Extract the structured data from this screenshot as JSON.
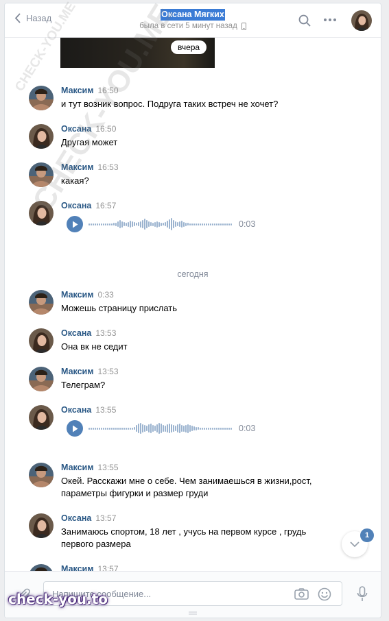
{
  "header": {
    "back_label": "Назад",
    "title": "Оксана Мягких",
    "status": "была в сети 5 минут назад"
  },
  "media_badge": "вчера",
  "messages": [
    {
      "name": "Максим",
      "time": "16:50",
      "text": "и тут возник вопрос. Подруга таких встреч не хочет?"
    },
    {
      "name": "Оксана",
      "time": "16:50",
      "text": "Другая может"
    },
    {
      "name": "Максим",
      "time": "16:53",
      "text": "какая?"
    },
    {
      "name": "Оксана",
      "time": "16:57",
      "voice_duration": "0:03"
    },
    {
      "name": "Максим",
      "time": "0:33",
      "text": "Можешь страницу прислать"
    },
    {
      "name": "Оксана",
      "time": "13:53",
      "text": "Она вк не седит"
    },
    {
      "name": "Максим",
      "time": "13:53",
      "text": "Телеграм?"
    },
    {
      "name": "Оксана",
      "time": "13:55",
      "voice_duration": "0:03"
    },
    {
      "name": "Максим",
      "time": "13:55",
      "text_line1": "Окей. Расскажи мне о себе. Чем занимаешься в жизни,рост,",
      "text_line2": "параметры фигурки и размер груди"
    },
    {
      "name": "Оксана",
      "time": "13:57",
      "text_line1": "Занимаюсь спортом, 18 лет , учусь на первом курсе , грудь",
      "text_line2": "первого размера"
    },
    {
      "name": "Максим",
      "time": "13:57"
    }
  ],
  "separator_today": "сегодня",
  "composer": {
    "placeholder": "Напишите сообщение..."
  },
  "unread_count": "1",
  "watermarks": {
    "diagonal": "CHECK-YOU.ME",
    "bottom": "check-you.to"
  },
  "colors": {
    "accent": "#5181b8",
    "name": "#2a5885",
    "title_highlight": "#3a7bd5"
  }
}
